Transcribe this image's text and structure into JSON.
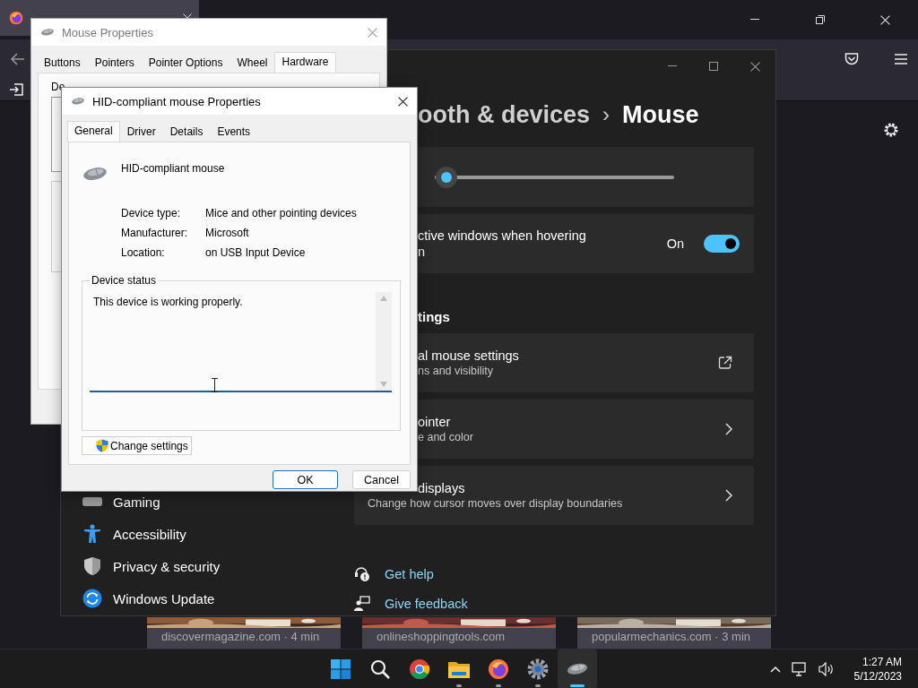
{
  "browser": {
    "tiles": [
      {
        "caption": "discovermagazine.com · 4 min"
      },
      {
        "caption": "onlineshoppingtools.com"
      },
      {
        "caption": "popularmechanics.com · 3 min"
      }
    ]
  },
  "settings_window": {
    "breadcrumb_parent": "ooth & devices",
    "breadcrumb_separator": "›",
    "title": "Mouse",
    "speed_slider": {
      "level": 0.05
    },
    "scroll_inactive": {
      "label_line_1": "ctive windows when hovering",
      "label_line_2": "n",
      "state_text": "On",
      "on": true
    },
    "section_heading": "tings",
    "links": [
      {
        "title": "al mouse settings",
        "subtitle": "ns and visibility",
        "kind": "external"
      },
      {
        "title": "ointer",
        "subtitle": "e and color",
        "kind": "chevron"
      },
      {
        "title": "displays",
        "subtitle": "Change how cursor moves over display boundaries",
        "kind": "chevron"
      }
    ],
    "help": [
      {
        "label": "Get help",
        "kind": "help"
      },
      {
        "label": "Give feedback",
        "kind": "feedback"
      }
    ],
    "sidebar": {
      "items": [
        {
          "label": "Gaming",
          "kind": "gaming"
        },
        {
          "label": "Accessibility",
          "kind": "accessibility"
        },
        {
          "label": "Privacy & security",
          "kind": "privacy"
        },
        {
          "label": "Windows Update",
          "kind": "update"
        }
      ]
    }
  },
  "mouse_properties": {
    "title": "Mouse Properties",
    "devices_label": "De",
    "tabs": [
      {
        "label": "Buttons",
        "selected": false
      },
      {
        "label": "Pointers",
        "selected": false
      },
      {
        "label": "Pointer Options",
        "selected": false
      },
      {
        "label": "Wheel",
        "selected": false
      },
      {
        "label": "Hardware",
        "selected": true
      }
    ]
  },
  "device_dialog": {
    "title": "HID-compliant mouse Properties",
    "tabs": [
      {
        "label": "General",
        "selected": true
      },
      {
        "label": "Driver",
        "selected": false
      },
      {
        "label": "Details",
        "selected": false
      },
      {
        "label": "Events",
        "selected": false
      }
    ],
    "device_name": "HID-compliant mouse",
    "properties": [
      {
        "label": "Device type:",
        "value": "Mice and other pointing devices"
      },
      {
        "label": "Manufacturer:",
        "value": "Microsoft"
      },
      {
        "label": "Location:",
        "value": "on USB Input Device"
      }
    ],
    "status_group": "Device status",
    "status_text": "This device is working properly.",
    "change_button": "Change settings",
    "buttons": [
      {
        "label": "OK",
        "default": true
      },
      {
        "label": "Cancel",
        "default": false
      }
    ]
  },
  "taskbar": {
    "apps": [
      {
        "kind": "start",
        "running": false,
        "active": false
      },
      {
        "kind": "search",
        "running": false,
        "active": false
      },
      {
        "kind": "chrome",
        "running": false,
        "active": false
      },
      {
        "kind": "explorer",
        "running": true,
        "active": false
      },
      {
        "kind": "firefox",
        "running": true,
        "active": false
      },
      {
        "kind": "settings",
        "running": true,
        "active": false
      },
      {
        "kind": "mouse",
        "running": true,
        "active": true
      }
    ],
    "time": "1:27 AM",
    "date": "5/12/2023"
  }
}
